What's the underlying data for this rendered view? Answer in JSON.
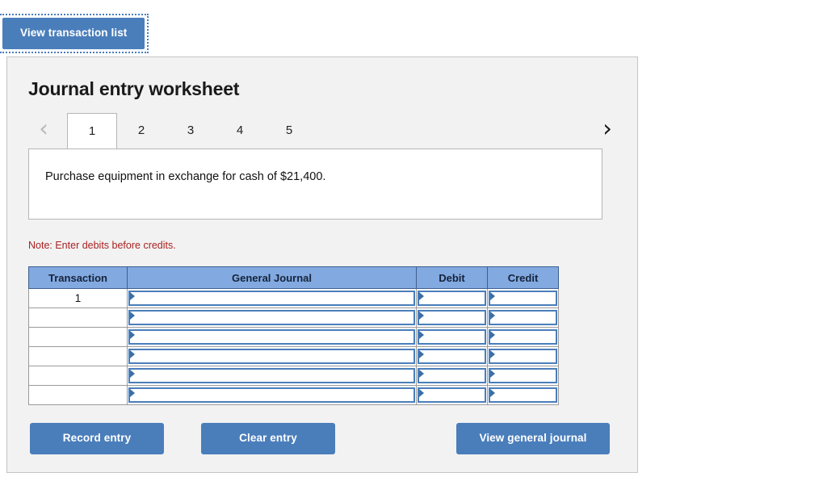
{
  "top_button": {
    "label": "View transaction list",
    "name": "view-transaction-list-button"
  },
  "panel": {
    "title": "Journal entry worksheet",
    "note": "Note: Enter debits before credits."
  },
  "tabs": {
    "prev_icon": "‹",
    "next_icon": "›",
    "items": [
      {
        "label": "1",
        "active": true
      },
      {
        "label": "2",
        "active": false
      },
      {
        "label": "3",
        "active": false
      },
      {
        "label": "4",
        "active": false
      },
      {
        "label": "5",
        "active": false
      }
    ]
  },
  "description": {
    "text": "Purchase equipment in exchange for cash of $21,400."
  },
  "table": {
    "headers": [
      "Transaction",
      "General Journal",
      "Debit",
      "Credit"
    ],
    "rows": [
      {
        "transaction": "1",
        "general_journal": "",
        "debit": "",
        "credit": ""
      },
      {
        "transaction": "",
        "general_journal": "",
        "debit": "",
        "credit": ""
      },
      {
        "transaction": "",
        "general_journal": "",
        "debit": "",
        "credit": ""
      },
      {
        "transaction": "",
        "general_journal": "",
        "debit": "",
        "credit": ""
      },
      {
        "transaction": "",
        "general_journal": "",
        "debit": "",
        "credit": ""
      },
      {
        "transaction": "",
        "general_journal": "",
        "debit": "",
        "credit": ""
      }
    ]
  },
  "actions": {
    "record": "Record entry",
    "clear": "Clear entry",
    "view_journal": "View general journal"
  },
  "colors": {
    "button_blue": "#4a7ebb",
    "header_blue": "#82a9e0",
    "field_border_blue": "#4a7ebb",
    "note_red": "#aa2222",
    "panel_bg": "#f2f2f2",
    "panel_border": "#c4c4c4"
  }
}
